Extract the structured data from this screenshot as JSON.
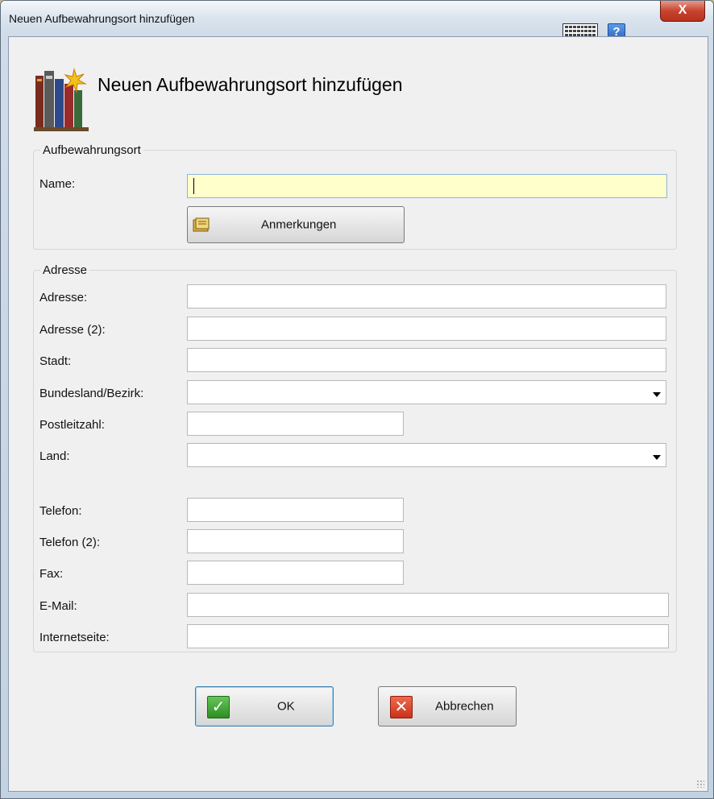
{
  "window": {
    "title": "Neuen Aufbewahrungsort hinzufügen",
    "close_glyph": "X",
    "help_glyph": "?"
  },
  "header": {
    "title": "Neuen Aufbewahrungsort hinzufügen",
    "icon": "bookshelf-icon"
  },
  "storage_group": {
    "legend": "Aufbewahrungsort",
    "name_label": "Name:",
    "name_value": "",
    "notes_button": "Anmerkungen"
  },
  "address_group": {
    "legend": "Adresse",
    "fields": {
      "address": {
        "label": "Adresse:",
        "value": ""
      },
      "address2": {
        "label": "Adresse (2):",
        "value": ""
      },
      "city": {
        "label": "Stadt:",
        "value": ""
      },
      "state": {
        "label": "Bundesland/Bezirk:",
        "value": ""
      },
      "zip": {
        "label": "Postleitzahl:",
        "value": ""
      },
      "country": {
        "label": "Land:",
        "value": ""
      },
      "phone": {
        "label": "Telefon:",
        "value": ""
      },
      "phone2": {
        "label": "Telefon (2):",
        "value": ""
      },
      "fax": {
        "label": "Fax:",
        "value": ""
      },
      "email": {
        "label": "E-Mail:",
        "value": ""
      },
      "website": {
        "label": "Internetseite:",
        "value": ""
      }
    }
  },
  "buttons": {
    "ok": "OK",
    "cancel": "Abbrechen"
  },
  "colors": {
    "focused_field": "#ffffcc",
    "dialog_bg": "#f0f0f0",
    "ok_icon": "#2c8f22",
    "cancel_icon": "#c9321a"
  }
}
